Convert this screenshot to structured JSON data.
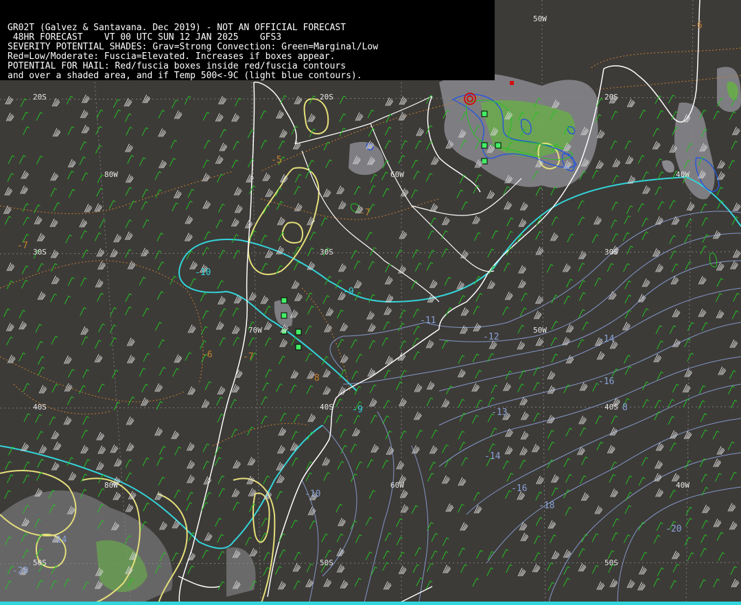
{
  "header": {
    "line1": "GR02T (Galvez & Santavana. Dec 2019) - NOT AN OFFICIAL FORECAST",
    "line2": " 48HR FORECAST    VT 00 UTC SUN 12 JAN 2025    GFS3",
    "line3": "SEVERITY POTENTIAL SHADES: Grav=Strong Convection: Green=Marginal/Low",
    "line4": "Red=Low/Moderate: Fuscia=Elevated. Increases if boxes appear.",
    "line5": "POTENTIAL FOR HAIL: Red/fuscia boxes inside red/fuscia contours",
    "line6": "and over a shaded area, and if Temp 500<-9C (light blue contours)."
  },
  "grid_labels": {
    "lat_20s_a": "20S",
    "lat_20s_b": "20S",
    "lat_20s_c": "20S",
    "lat_30s_a": "30S",
    "lat_30s_b": "30S",
    "lat_30s_c": "30S",
    "lat_40s_a": "40S",
    "lat_40s_b": "40S",
    "lat_40s_c": "40S",
    "lat_50s_a": "50S",
    "lat_50s_b": "50S",
    "lat_50s_c": "50S",
    "lon_50w_a": "50W",
    "lon_50w_b": "50W",
    "lon_80w_a": "80W",
    "lon_80w_b": "80W",
    "lon_60w_a": "60W",
    "lon_60w_b": "60W",
    "lon_40w_a": "40W",
    "lon_40w_b": "40W",
    "lon_70w": "70W"
  },
  "contour_labels": {
    "temp_m10_a": "-10",
    "temp_m9_a": "-9",
    "temp_m9_b": "-9",
    "temp_m8": "-8",
    "temp_m7_a": "-7",
    "temp_m7_b": "-7",
    "temp_m6_a": "-6",
    "temp_m6_b": "-6",
    "temp_m5": "-5",
    "temp_m11": "-11",
    "temp_m12": "-12",
    "temp_m13": "-13",
    "temp_m14_a": "-14",
    "temp_m14_b": "-14",
    "temp_m16_a": "-16",
    "temp_m16_b": "-16",
    "temp_m18": "-18",
    "temp_m20": "-20",
    "temp_m10_b": "-10",
    "temp_m12_b": "12",
    "temp_m8_b": "8",
    "temp_m14_c": "-14",
    "temp_m20_b": "-20"
  },
  "colors": {
    "background": "#3d3b38",
    "coastline": "#ffffff",
    "temp_light_blue": "#33d6dc",
    "temp_cold": "#8aa2d8",
    "orange_dotted": "#c8802c",
    "yellow_contour": "#e6e07a",
    "wind_barb_green": "#22c322",
    "wind_barb_white": "#d8d8d8",
    "gray_shade": "#8a8a8e",
    "green_shade": "#6aa84f",
    "box_green": "#44ee66",
    "red_marker": "#d01010"
  }
}
